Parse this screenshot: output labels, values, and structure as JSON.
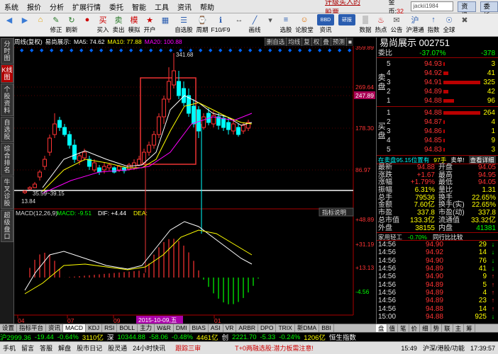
{
  "menu": {
    "items": [
      "系统",
      "报价",
      "分析",
      "扩展行情",
      "委托",
      "智能",
      "工具",
      "资讯",
      "帮助"
    ],
    "ad": "评级买入的股票",
    "gold_label": "金币:",
    "gold_value": "32",
    "user": "jackii1984",
    "btn1": "资讯",
    "btn2": "委托"
  },
  "toolbar": [
    {
      "label": "",
      "icon": "◀",
      "color": "#3a7bd5",
      "name": "back"
    },
    {
      "label": "",
      "icon": "▶",
      "color": "#3a7bd5",
      "name": "forward"
    },
    {
      "label": "",
      "icon": "⌂",
      "color": "#e0a000",
      "name": "home"
    },
    {
      "label": "修正",
      "icon": "✎",
      "color": "#2a7a2a",
      "name": "edit"
    },
    {
      "label": "刷新",
      "icon": "↻",
      "color": "#2a7a2a",
      "name": "refresh"
    },
    {
      "label": "",
      "icon": "●",
      "color": "#c00",
      "name": "record"
    },
    {
      "label": "买入",
      "icon": "买",
      "color": "#c00",
      "name": "buy"
    },
    {
      "label": "卖出",
      "icon": "卖",
      "color": "#2a7a2a",
      "name": "sell"
    },
    {
      "label": "模拟",
      "icon": "模",
      "color": "#c00",
      "name": "simulate"
    },
    {
      "label": "开户",
      "icon": "★",
      "color": "#c00",
      "name": "account"
    },
    {
      "label": "",
      "icon": "▦",
      "color": "#2a5db0",
      "name": "grid"
    },
    {
      "label": "自选股",
      "icon": "☰",
      "color": "#2a5db0",
      "name": "watchlist"
    },
    {
      "label": "周期",
      "icon": "⌚",
      "color": "#2a5db0",
      "name": "period"
    },
    {
      "label": "F10/F9",
      "icon": "ℹ",
      "color": "#2a5db0",
      "name": "f10"
    },
    {
      "label": "",
      "icon": "↔",
      "color": "#555",
      "name": "resize"
    },
    {
      "label": "画线",
      "icon": "╱",
      "color": "#2a5db0",
      "name": "draw"
    },
    {
      "label": "",
      "icon": "▾",
      "color": "#555",
      "name": "more"
    },
    {
      "label": "选股",
      "icon": "≡",
      "color": "#2a5db0",
      "name": "select"
    },
    {
      "label": "论股堂",
      "icon": "☺",
      "color": "#e07000",
      "name": "forum"
    },
    {
      "label": "资讯",
      "icon": "BBD",
      "color": "#2a5db0",
      "name": "bbd"
    },
    {
      "label": "",
      "icon": "研报",
      "color": "#2a5db0",
      "name": "report"
    },
    {
      "label": "数据",
      "icon": "▒",
      "color": "#555",
      "name": "data"
    },
    {
      "label": "热点",
      "icon": "♨",
      "color": "#c00",
      "name": "hot"
    },
    {
      "label": "公告",
      "icon": "✉",
      "color": "#555",
      "name": "notice"
    },
    {
      "label": "沪港通",
      "icon": "沪",
      "color": "#2a5db0",
      "name": "hk"
    },
    {
      "label": "指数",
      "icon": "↑",
      "color": "#2a5db0",
      "name": "index"
    },
    {
      "label": "全球",
      "icon": "☉",
      "color": "#2a5db0",
      "name": "global"
    },
    {
      "label": "",
      "icon": "✖",
      "color": "#555",
      "name": "close"
    }
  ],
  "leftnav": [
    "分时图",
    "K线图",
    "个股资料",
    "自选股",
    "综合排名",
    "牛叉诊股",
    "超级盘口"
  ],
  "chart_header": {
    "period": "周线(复权)",
    "stock": "易尚展示:",
    "ma5": "MA5: 74.62",
    "ma10": "MA10: 77.88",
    "ma20": "MA20: 100.88",
    "controls": [
      "删自选",
      "均线",
      "复",
      "权",
      "叠",
      "预测",
      "■"
    ]
  },
  "chart_labels": {
    "high": "341.68",
    "low": "13.84",
    "range": "35.59~39.15",
    "macd": "MACD(12,26,9)",
    "macd_val": "MACD: -9.51",
    "dif": "DIF: +4.44",
    "dea": "DEA:",
    "explain": "指标说明",
    "date": "2015-10-09,五"
  },
  "chart_data": {
    "type": "candlestick",
    "y_ticks": [
      "359.89",
      "269.64",
      "247.89",
      "178.30",
      "86.97"
    ],
    "macd_ticks": [
      "+48.89",
      "+31.19",
      "+13.13",
      "-4.56"
    ],
    "x_ticks": [
      "04",
      "07",
      "09",
      "01"
    ],
    "ylim": [
      0,
      360
    ]
  },
  "right": {
    "title": "易尚展示 002751",
    "webi": [
      "委比",
      "-37.07%",
      "-378"
    ],
    "sell": [
      {
        "lv": "5",
        "price": "94.93",
        "vol": "3"
      },
      {
        "lv": "4",
        "price": "94.92",
        "vol": "41"
      },
      {
        "lv": "3",
        "price": "94.91",
        "vol": "325"
      },
      {
        "lv": "2",
        "price": "94.89",
        "vol": "42"
      },
      {
        "lv": "1",
        "price": "94.88",
        "vol": "96"
      }
    ],
    "buy": [
      {
        "lv": "1",
        "price": "94.88",
        "vol": "264"
      },
      {
        "lv": "2",
        "price": "94.87",
        "vol": "4"
      },
      {
        "lv": "3",
        "price": "94.86",
        "vol": "1"
      },
      {
        "lv": "4",
        "price": "94.85",
        "vol": "9"
      },
      {
        "lv": "5",
        "price": "94.83",
        "vol": "3"
      }
    ],
    "side_sell": "卖盘",
    "side_buy": "买盘",
    "stat_head": [
      "在卖盘95.15位置有",
      "97手",
      "卖单!",
      "查看详细"
    ],
    "stats": [
      [
        "最新",
        "94.88",
        "开盘",
        "94.05"
      ],
      [
        "涨跌",
        "+1.67",
        "最高",
        "94.95"
      ],
      [
        "涨幅",
        "+1.79%",
        "最低",
        "94.05"
      ],
      [
        "振幅",
        "6.31%",
        "量比",
        "1.31"
      ],
      [
        "总手",
        "79536",
        "换手",
        "22.65%"
      ],
      [
        "金额",
        "7.60亿",
        "换手(实)",
        "22.65%"
      ],
      [
        "市盈",
        "337.8",
        "市盈(动)",
        "337.8"
      ],
      [
        "总市值",
        "133.3亿",
        "流通值",
        "33.32亿"
      ],
      [
        "外盘",
        "38155",
        "内盘",
        "41381"
      ]
    ],
    "industry": [
      "家用轻工",
      "-0.70%",
      "同行比比较"
    ],
    "ticks": [
      {
        "t": "14:56",
        "p": "94.90",
        "v": "29",
        "ar": "↓"
      },
      {
        "t": "14:56",
        "p": "94.92",
        "v": "14",
        "ar": "↓"
      },
      {
        "t": "14:56",
        "p": "94.90",
        "v": "76",
        "ar": "↓"
      },
      {
        "t": "14:56",
        "p": "94.89",
        "v": "41",
        "ar": "↓"
      },
      {
        "t": "14:56",
        "p": "94.90",
        "v": "9",
        "ar": "↑"
      },
      {
        "t": "14:56",
        "p": "94.89",
        "v": "5",
        "ar": "↑"
      },
      {
        "t": "14:56",
        "p": "94.89",
        "v": "4",
        "ar": "↑"
      },
      {
        "t": "14:56",
        "p": "94.89",
        "v": "23",
        "ar": "↑"
      },
      {
        "t": "14:56",
        "p": "94.88",
        "v": "14",
        "ar": "↑"
      },
      {
        "t": "15:00",
        "p": "94.88",
        "v": "925",
        "ar": "↓"
      }
    ]
  },
  "tabs": [
    "设置",
    "指标平台",
    "资讯",
    "MACD",
    "KDJ",
    "RSI",
    "BOLL",
    "主力",
    "W&R",
    "DMI",
    "BIAS",
    "ASI",
    "VR",
    "ARBR",
    "DPO",
    "TRIX",
    "新DMA",
    "BBI"
  ],
  "rtabs": [
    "盘",
    "值",
    "笔",
    "价",
    "细",
    "势",
    "联",
    "主",
    "筹"
  ],
  "ticker": [
    {
      "t": "沪2999.36",
      "c": "#0f0"
    },
    {
      "t": "-19.44",
      "c": "#0f0"
    },
    {
      "t": "-0.64%",
      "c": "#0f0"
    },
    {
      "t": "3110亿",
      "c": "#ff0"
    },
    {
      "t": "深",
      "c": "#fff"
    },
    {
      "t": "10344.88",
      "c": "#0f0"
    },
    {
      "t": "-58.06",
      "c": "#0f0"
    },
    {
      "t": "-0.48%",
      "c": "#0f0"
    },
    {
      "t": "4461亿",
      "c": "#ff0"
    },
    {
      "t": "创",
      "c": "#fff"
    },
    {
      "t": "2221.70",
      "c": "#0f0"
    },
    {
      "t": "-5.33",
      "c": "#0f0"
    },
    {
      "t": "-0.24%",
      "c": "#0f0"
    },
    {
      "t": "1206亿",
      "c": "#ff0"
    },
    {
      "t": "恒生指数",
      "c": "#fff"
    }
  ],
  "status": {
    "items": [
      "手机",
      "留言",
      "答服",
      "解盘",
      "股市日记",
      "股灵通",
      "24小时快讯"
    ],
    "promo": "跟踪三审",
    "promo2": "T+0两融选股:潜力板需注意!",
    "time_a": "15:49",
    "ticker_a": "沪深/港股/功能",
    "time_b": "17:39:57"
  }
}
